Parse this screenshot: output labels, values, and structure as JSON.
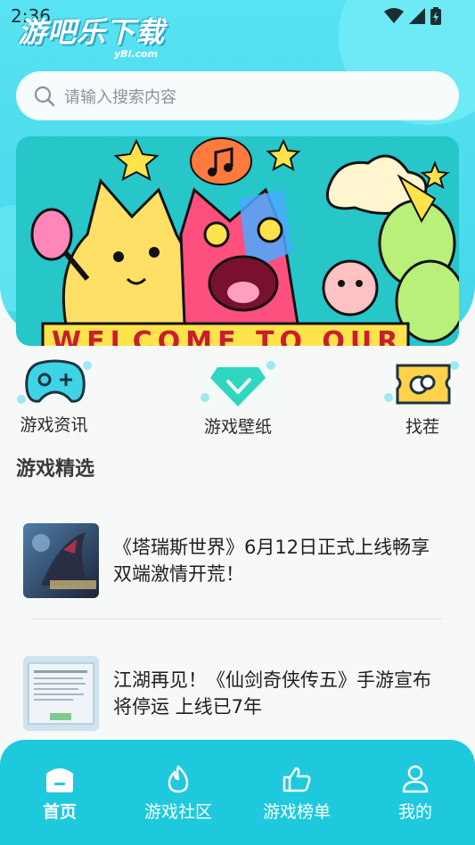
{
  "status_bar": {
    "time": "2:36"
  },
  "logo": {
    "main": "游吧乐下载",
    "sub": "yBl.com"
  },
  "search": {
    "placeholder": "请输入搜索内容"
  },
  "banner": {
    "text": "WELCOME TO OUR"
  },
  "categories": [
    {
      "label": "游戏资讯",
      "icon": "gamepad-icon"
    },
    {
      "label": "游戏壁纸",
      "icon": "diamond-check-icon"
    },
    {
      "label": "找茬",
      "icon": "ticket-chat-icon"
    }
  ],
  "section": {
    "title": "游戏精选"
  },
  "news": [
    {
      "title": "《塔瑞斯世界》6月12日正式上线畅享双端激情开荒！"
    },
    {
      "title": "江湖再见！《仙剑奇侠传五》手游宣布将停运 上线已7年"
    }
  ],
  "tabs": [
    {
      "label": "首页",
      "icon": "home-icon",
      "active": true
    },
    {
      "label": "游戏社区",
      "icon": "flame-icon",
      "active": false
    },
    {
      "label": "游戏榜单",
      "icon": "thumbs-up-icon",
      "active": false
    },
    {
      "label": "我的",
      "icon": "user-icon",
      "active": false
    }
  ],
  "colors": {
    "accent": "#1fc9dd",
    "hero": "#58e3f2"
  }
}
